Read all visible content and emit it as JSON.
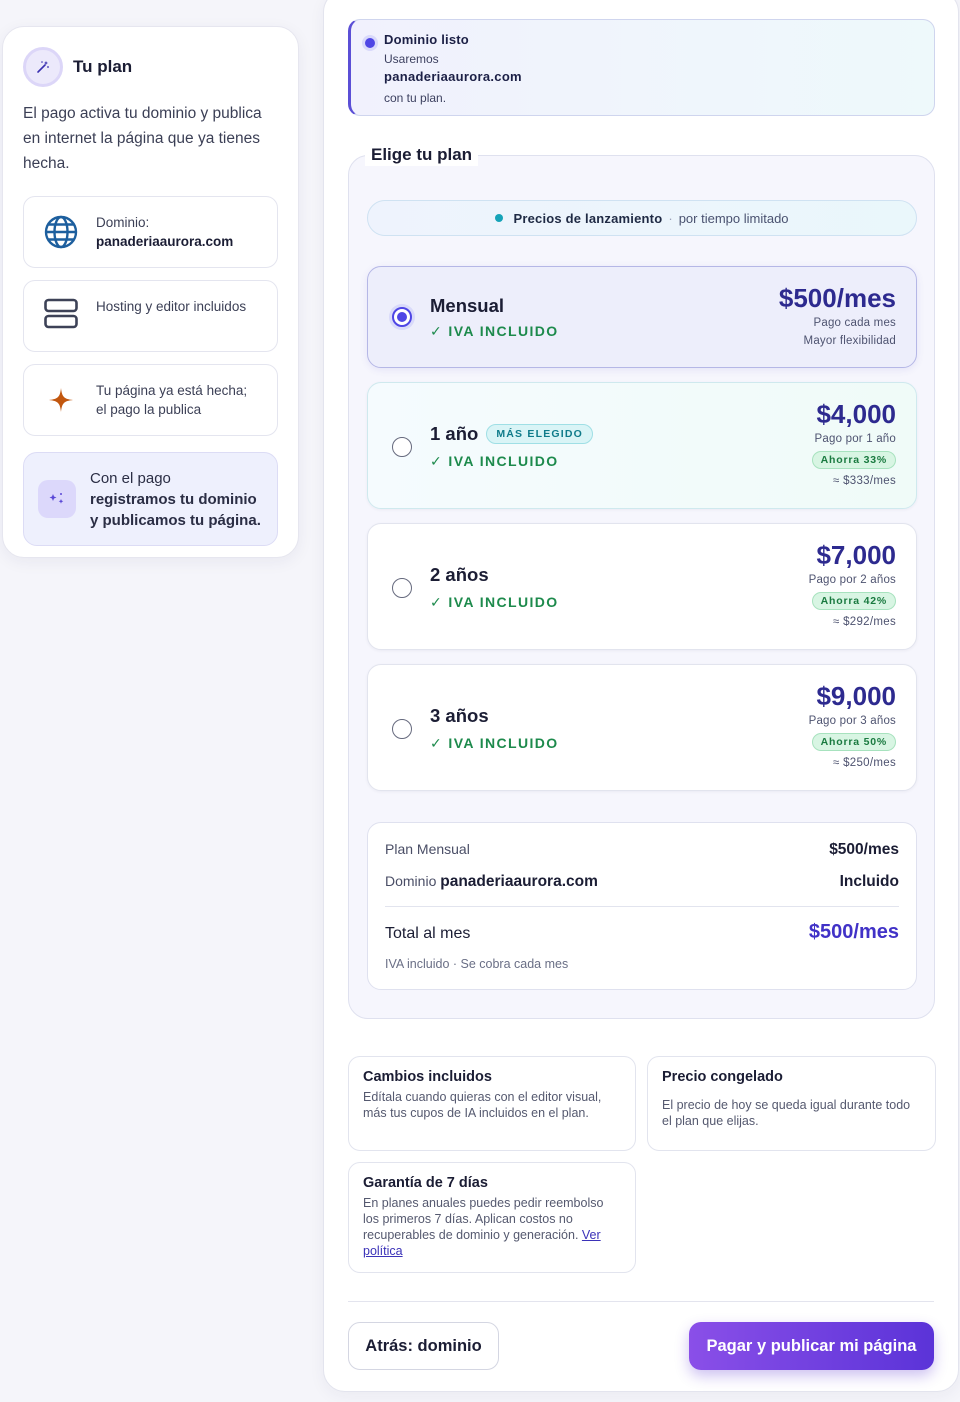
{
  "sidebar": {
    "title": "Tu plan",
    "description": "El pago activa tu dominio y publica en internet la página que ya tienes hecha.",
    "cards": [
      {
        "icon": "globe-icon",
        "label": "Dominio:",
        "value": "panaderiaaurora.com"
      },
      {
        "icon": "server-icon",
        "label": "Hosting y editor incluidos"
      },
      {
        "icon": "sparkle-icon",
        "label": "Tu página ya está hecha; el pago la publica"
      }
    ],
    "note": {
      "icon": "sparkles-icon",
      "line1": "Con el pago",
      "line2": "registramos tu dominio",
      "line3": "y publicamos tu página."
    }
  },
  "banner": {
    "heading": "Dominio listo",
    "line1": "Usaremos",
    "domain": "panaderiaaurora.com",
    "line2": "con tu plan."
  },
  "plans_section": {
    "title": "Elige tu plan",
    "launch_bold": "Precios de lanzamiento",
    "launch_sep": "·",
    "launch_text": "por tiempo limitado",
    "plans": [
      {
        "name": "Mensual",
        "iva": "✓ IVA INCLUIDO",
        "price": "$500/mes",
        "sub1": "Pago cada mes",
        "sub2": "Mayor flexibilidad",
        "selected": true
      },
      {
        "name": "1 año",
        "badge": "MÁS ELEGIDO",
        "iva": "✓ IVA INCLUIDO",
        "price": "$4,000",
        "sub1": "Pago por 1 año",
        "save": "Ahorra 33%",
        "monthly": "≈ $333/mes"
      },
      {
        "name": "2 años",
        "iva": "✓ IVA INCLUIDO",
        "price": "$7,000",
        "sub1": "Pago por 2 años",
        "save": "Ahorra 42%",
        "monthly": "≈ $292/mes"
      },
      {
        "name": "3 años",
        "iva": "✓ IVA INCLUIDO",
        "price": "$9,000",
        "sub1": "Pago por 3 años",
        "save": "Ahorra 50%",
        "monthly": "≈ $250/mes"
      }
    ]
  },
  "summary": {
    "plan_label": "Plan Mensual",
    "plan_value": "$500/mes",
    "domain_label": "Dominio",
    "domain_name": "panaderiaaurora.com",
    "domain_value": "Incluido",
    "total_label": "Total al mes",
    "total_value": "$500/mes",
    "note": "IVA incluido · Se cobra cada mes"
  },
  "info": {
    "changes_title": "Cambios incluidos",
    "changes_body": "Edítala cuando quieras con el editor visual, más tus cupos de IA incluidos en el plan.",
    "price_title": "Precio congelado",
    "price_body": "El precio de hoy se queda igual durante todo el plan que elijas.",
    "guarantee_title": "Garantía de 7 días",
    "guarantee_body": "En planes anuales puedes pedir reembolso los primeros 7 días. Aplican costos no recuperables de dominio y generación.",
    "guarantee_link": "Ver política"
  },
  "actions": {
    "back": "Atrás: dominio",
    "pay": "Pagar y publicar mi página"
  },
  "colors": {
    "accent": "#4f46e5",
    "price": "#2d2a8f",
    "iva_green": "#1d8a4c",
    "pay_gradient_start": "#8a4fe8",
    "pay_gradient_end": "#5b33d8"
  }
}
